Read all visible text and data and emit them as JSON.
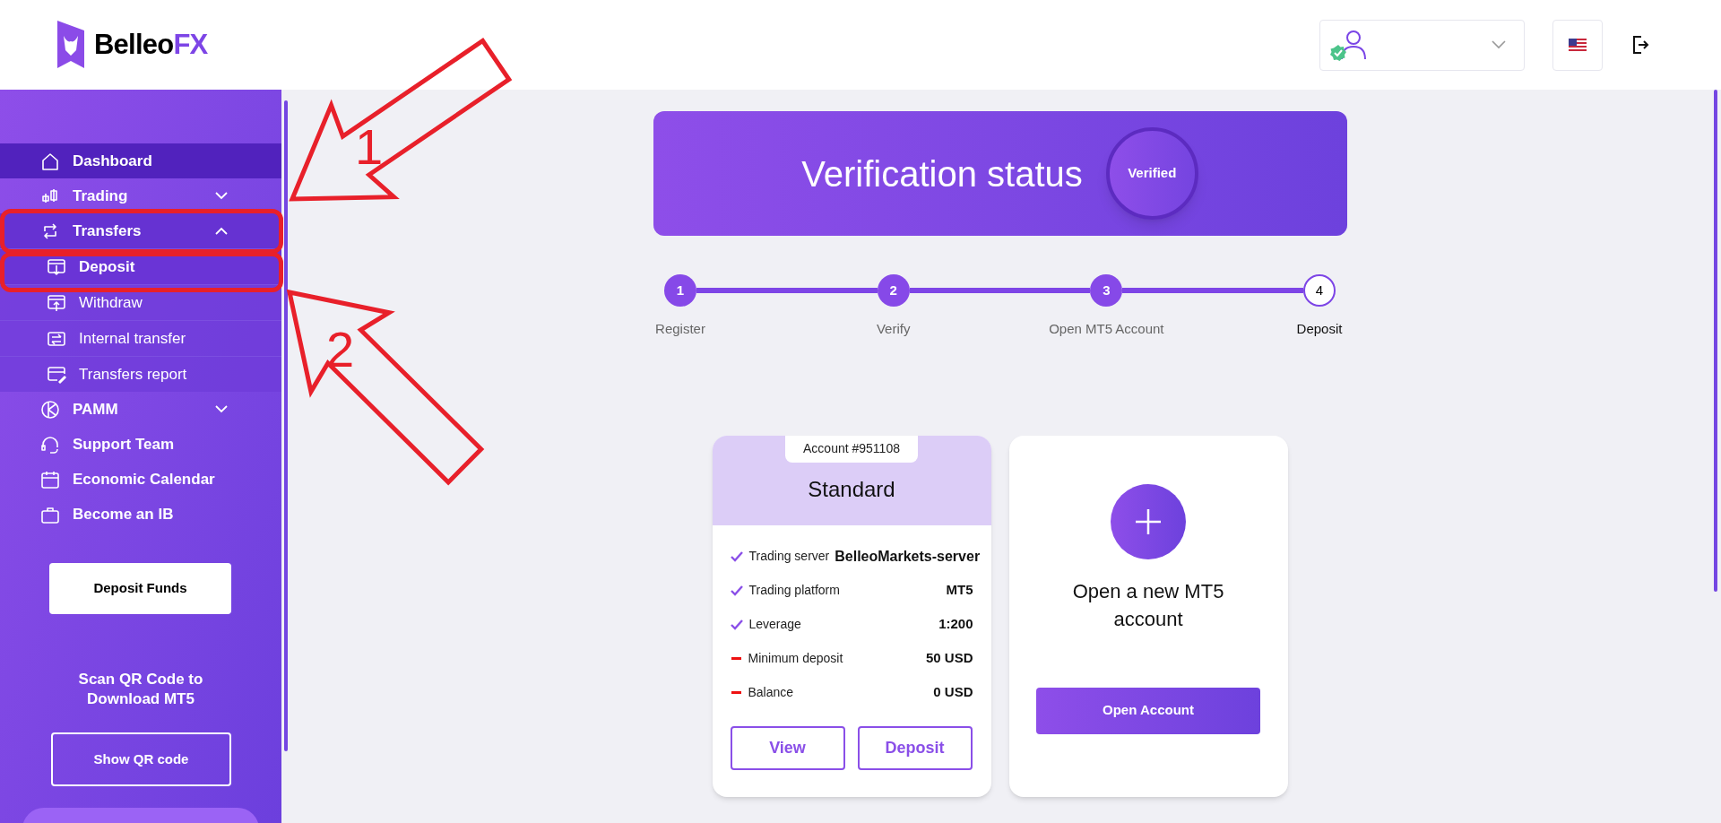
{
  "header": {
    "logo": {
      "text": "Belleo",
      "accent": "FX"
    },
    "user_verified": true
  },
  "sidebar": {
    "items": [
      {
        "label": "Dashboard",
        "selected": true,
        "expandable": false,
        "expanded": false
      },
      {
        "label": "Trading",
        "selected": false,
        "expandable": true,
        "expanded": false
      },
      {
        "label": "Transfers",
        "selected": false,
        "expandable": true,
        "expanded": true,
        "children": [
          {
            "label": "Deposit",
            "selected": true
          },
          {
            "label": "Withdraw",
            "selected": false
          },
          {
            "label": "Internal transfer",
            "selected": false
          },
          {
            "label": "Transfers report",
            "selected": false
          }
        ]
      },
      {
        "label": "PAMM",
        "selected": false,
        "expandable": true,
        "expanded": false
      },
      {
        "label": "Support Team",
        "selected": false,
        "expandable": false,
        "expanded": false
      },
      {
        "label": "Economic Calendar",
        "selected": false,
        "expandable": false,
        "expanded": false
      },
      {
        "label": "Become an IB",
        "selected": false,
        "expandable": false,
        "expanded": false
      }
    ],
    "deposit_button": "Deposit Funds",
    "qr_text": "Scan QR Code to Download MT5",
    "qr_button": "Show QR code"
  },
  "verification": {
    "title": "Verification status",
    "status": "Verified"
  },
  "steps": [
    {
      "number": "1",
      "label": "Register",
      "done": true
    },
    {
      "number": "2",
      "label": "Verify",
      "done": true
    },
    {
      "number": "3",
      "label": "Open MT5 Account",
      "done": true
    },
    {
      "number": "4",
      "label": "Deposit",
      "done": false
    }
  ],
  "account_card": {
    "account": "Account #951108",
    "type": "Standard",
    "rows": [
      {
        "kind": "check",
        "label": "Trading server",
        "value": "BelleoMarkets-server"
      },
      {
        "kind": "check",
        "label": "Trading platform",
        "value": "MT5"
      },
      {
        "kind": "check",
        "label": "Leverage",
        "value": "1:200"
      },
      {
        "kind": "dash",
        "label": "Minimum deposit",
        "value": "50 USD"
      },
      {
        "kind": "dash",
        "label": "Balance",
        "value": "0 USD"
      }
    ],
    "buttons": [
      "View",
      "Deposit"
    ]
  },
  "new_account_card": {
    "title": "Open a new MT5 account",
    "button": "Open Account"
  },
  "annotations": [
    {
      "label": "1"
    },
    {
      "label": "2"
    }
  ]
}
